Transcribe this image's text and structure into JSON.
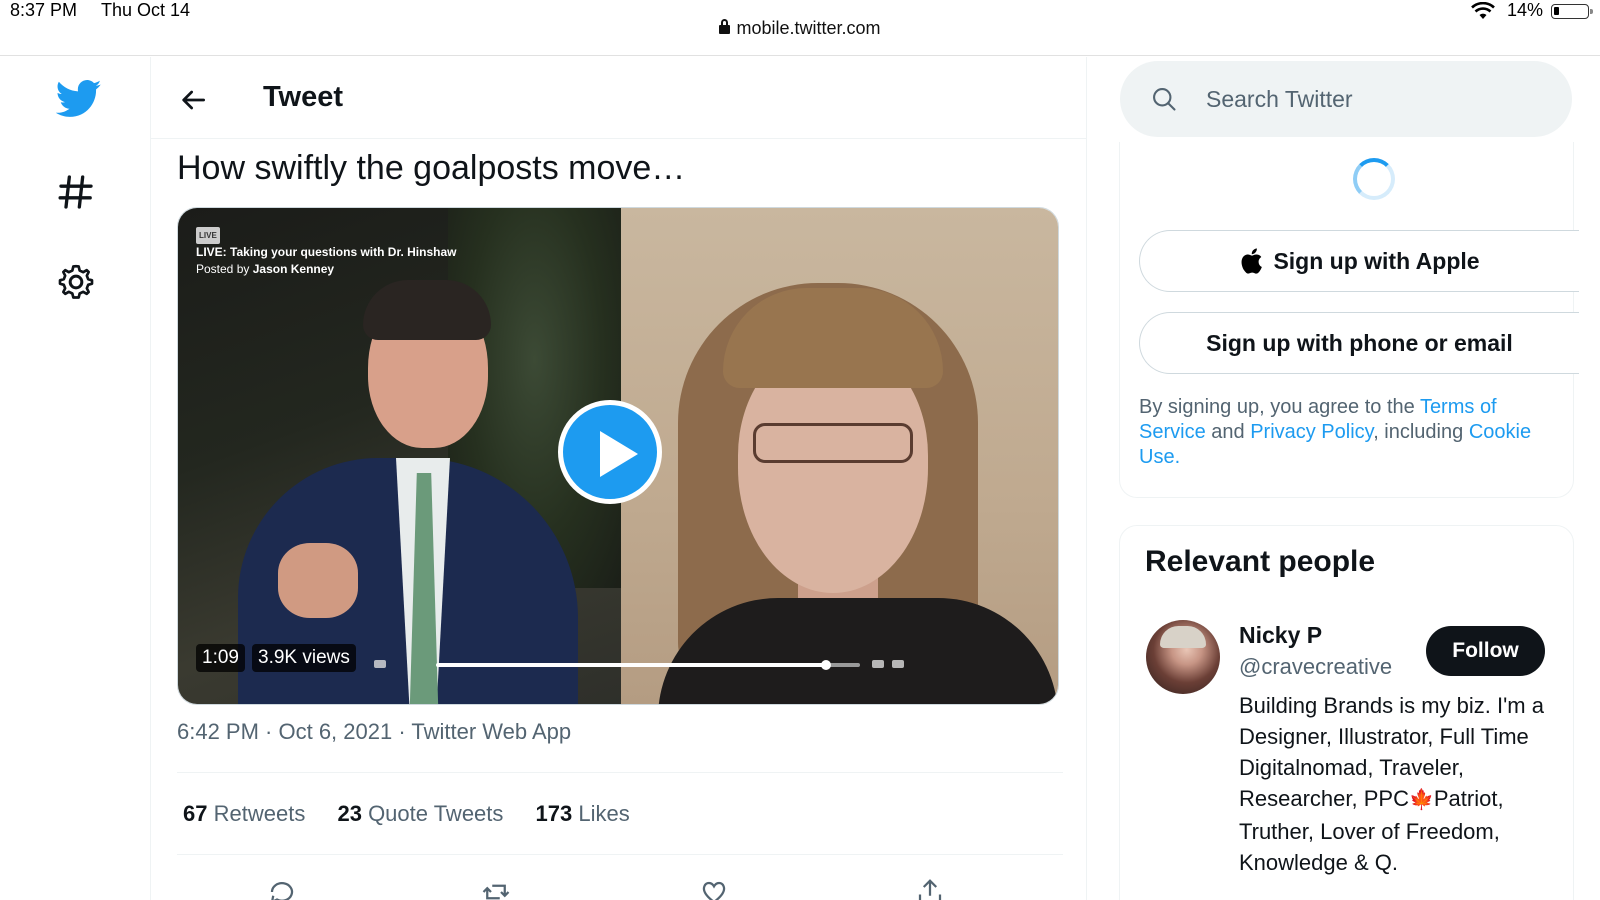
{
  "status_bar": {
    "time": "8:37 PM",
    "date": "Thu Oct 14",
    "url": "mobile.twitter.com",
    "battery": "14%"
  },
  "nav": {
    "items": [
      {
        "icon": "twitter-bird-icon",
        "color": "#1d9bf0"
      },
      {
        "icon": "hashtag-icon"
      },
      {
        "icon": "gear-icon"
      }
    ]
  },
  "header": {
    "title": "Tweet"
  },
  "tweet": {
    "text": "How swiftly the goalposts move…",
    "video": {
      "overlay_title": "LIVE: Taking your questions with Dr. Hinshaw",
      "overlay_posted_prefix": "Posted by",
      "overlay_posted_by": "Jason Kenney",
      "duration": "1:09",
      "views": "3.9K views",
      "progress": 0.92
    },
    "meta": "6:42 PM · Oct 6, 2021 · Twitter Web App",
    "stats": {
      "retweets_count": "67",
      "retweets_label": "Retweets",
      "quotes_count": "23",
      "quotes_label": "Quote Tweets",
      "likes_count": "173",
      "likes_label": "Likes"
    }
  },
  "search": {
    "placeholder": "Search Twitter"
  },
  "signup": {
    "apple_label": "Sign up with Apple",
    "phone_label": "Sign up with phone or email",
    "terms_prefix": "By signing up, you agree to the ",
    "terms_link": "Terms of Service",
    "terms_and": " and ",
    "privacy_link": "Privacy Policy",
    "terms_including": ", including ",
    "cookie_link": "Cookie Use",
    "terms_end": "."
  },
  "relevant_people": {
    "title": "Relevant people",
    "person": {
      "name": "Nicky P",
      "handle": "@cravecreative",
      "follow_label": "Follow",
      "bio_part1": "Building Brands is my biz. I'm a Designer, Illustrator, Full Time Digitalnomad, Traveler, Researcher, PPC",
      "bio_emoji": "🍁",
      "bio_part2": "Patriot, Truther, Lover of Freedom, Knowledge & Q."
    }
  },
  "colors": {
    "accent": "#1d9bf0",
    "text": "#0f1419",
    "secondary_text": "#536471"
  }
}
